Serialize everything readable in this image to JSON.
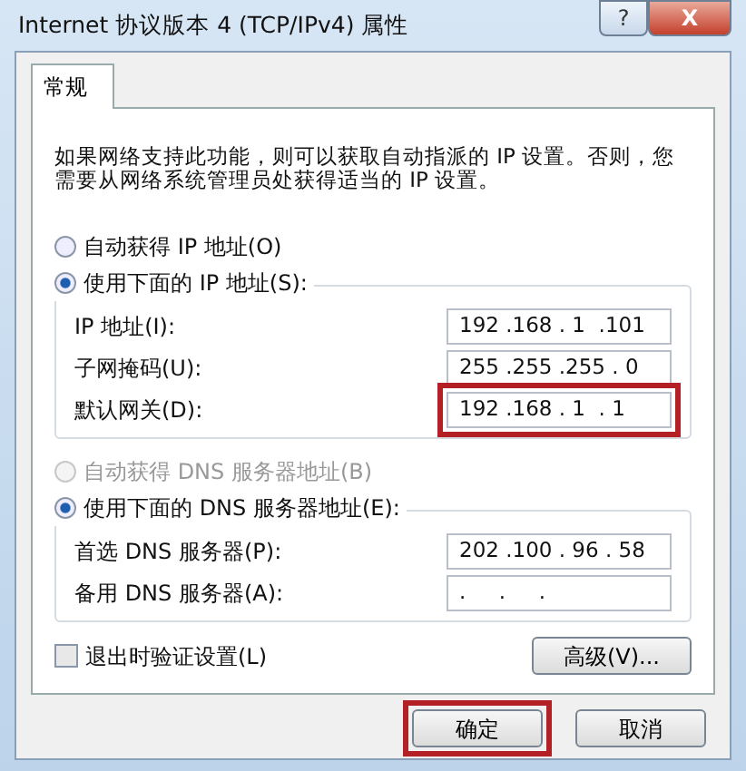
{
  "window": {
    "title": "Internet 协议版本 4 (TCP/IPv4) 属性",
    "help_button": "?",
    "close_button": "X"
  },
  "tabs": [
    {
      "label": "常规",
      "selected": true
    }
  ],
  "description": "如果网络支持此功能，则可以获取自动指派的 IP 设置。否则，您需要从网络系统管理员处获得适当的 IP 设置。",
  "ip_mode": [
    {
      "label": "自动获得 IP 地址(O)",
      "selected": false,
      "disabled": false
    },
    {
      "label": "使用下面的 IP 地址(S):",
      "selected": true,
      "disabled": false
    }
  ],
  "ip_fields": [
    {
      "label": "IP 地址(I):",
      "value": "192 .168 . 1  .101",
      "highlighted": false
    },
    {
      "label": "子网掩码(U):",
      "value": "255 .255 .255 . 0",
      "highlighted": false
    },
    {
      "label": "默认网关(D):",
      "value": "192 .168 . 1  . 1",
      "highlighted": true
    }
  ],
  "dns_mode": [
    {
      "label": "自动获得 DNS 服务器地址(B)",
      "selected": false,
      "disabled": true
    },
    {
      "label": "使用下面的 DNS 服务器地址(E):",
      "selected": true,
      "disabled": false
    }
  ],
  "dns_fields": [
    {
      "label": "首选 DNS 服务器(P):",
      "value": "202 .100 . 96 . 58",
      "highlighted": false
    },
    {
      "label": "备用 DNS 服务器(A):",
      "value": ".     .     .",
      "highlighted": false
    }
  ],
  "validate_checkbox": {
    "label": "退出时验证设置(L)",
    "checked": false
  },
  "advanced_button": "高级(V)...",
  "buttons": [
    {
      "label": "确定",
      "highlighted": true
    },
    {
      "label": "取消",
      "highlighted": false
    }
  ]
}
